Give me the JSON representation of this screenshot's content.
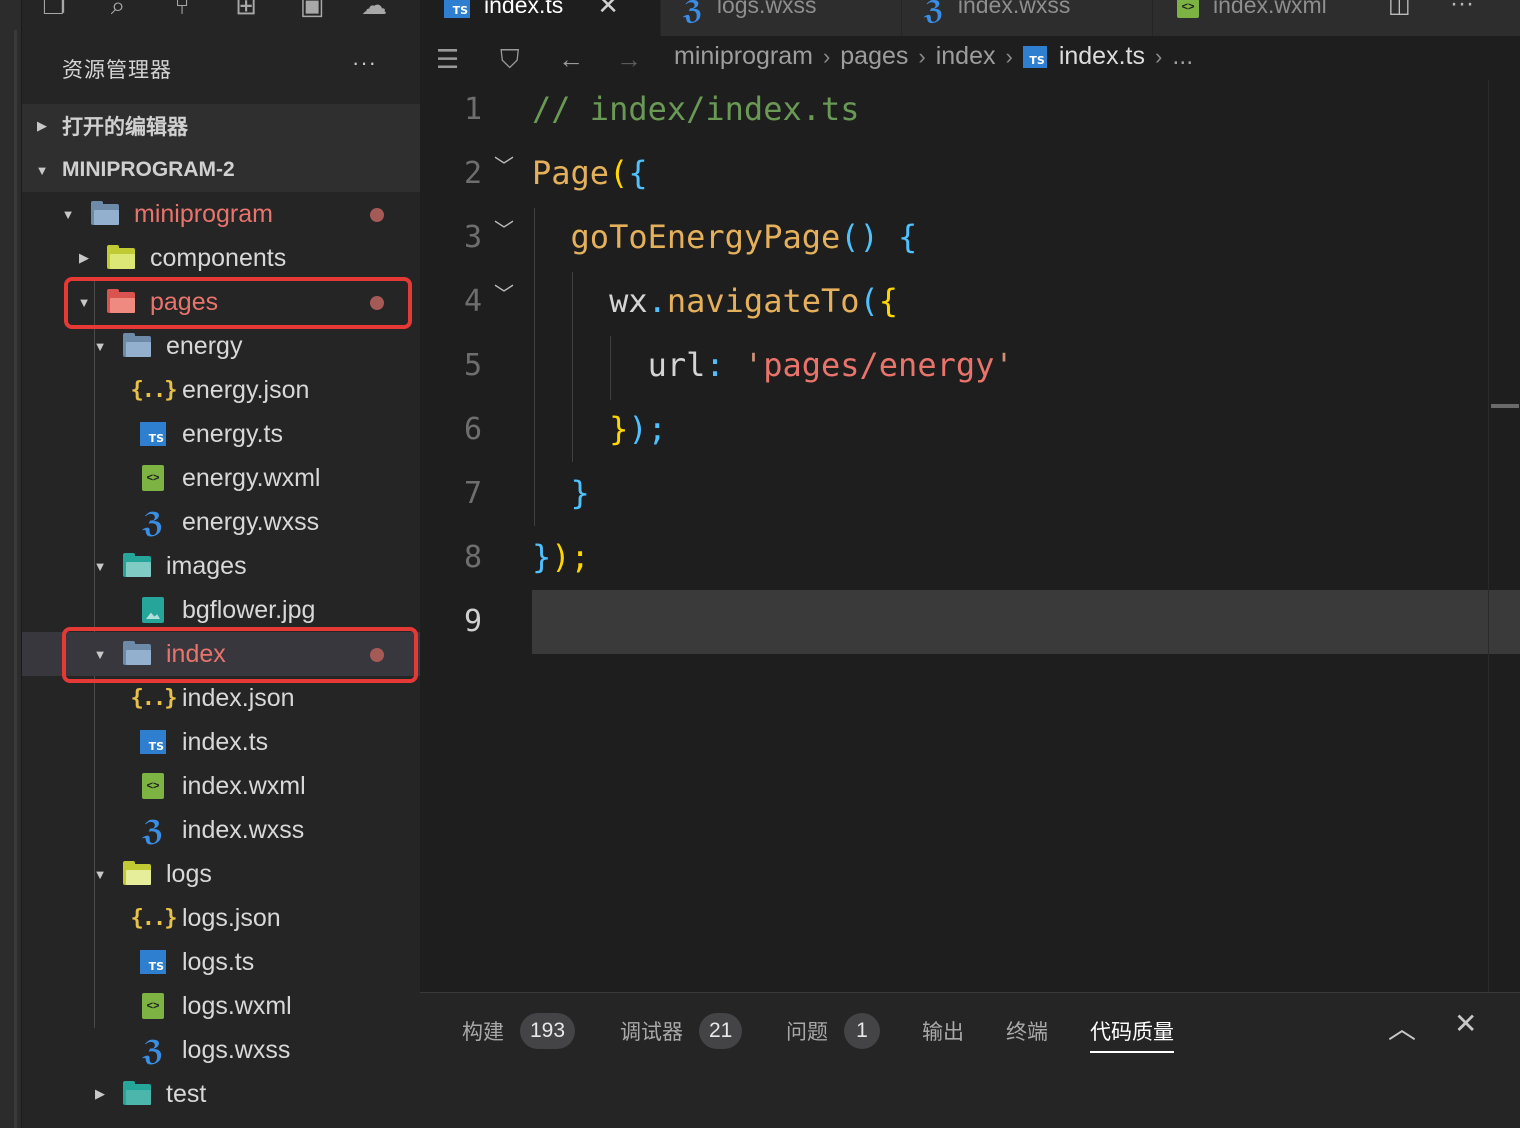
{
  "explorer": {
    "title": "资源管理器",
    "more": "···",
    "sections": [
      {
        "label": "打开的编辑器",
        "expanded": false
      },
      {
        "label": "MINIPROGRAM-2",
        "expanded": true
      }
    ],
    "tree": [
      {
        "name": "miniprogram",
        "type": "folder",
        "expanded": true,
        "modified": true
      },
      {
        "name": "components",
        "type": "folder",
        "expanded": false
      },
      {
        "name": "pages",
        "type": "folder",
        "expanded": true,
        "modified": true,
        "highlighted": true
      },
      {
        "name": "energy",
        "type": "folder",
        "expanded": true
      },
      {
        "name": "energy.json",
        "type": "json"
      },
      {
        "name": "energy.ts",
        "type": "ts"
      },
      {
        "name": "energy.wxml",
        "type": "wxml"
      },
      {
        "name": "energy.wxss",
        "type": "wxss"
      },
      {
        "name": "images",
        "type": "folder",
        "expanded": true
      },
      {
        "name": "bgflower.jpg",
        "type": "image"
      },
      {
        "name": "index",
        "type": "folder",
        "expanded": true,
        "modified": true,
        "highlighted": true,
        "selected": true
      },
      {
        "name": "index.json",
        "type": "json"
      },
      {
        "name": "index.ts",
        "type": "ts"
      },
      {
        "name": "index.wxml",
        "type": "wxml"
      },
      {
        "name": "index.wxss",
        "type": "wxss"
      },
      {
        "name": "logs",
        "type": "folder",
        "expanded": true
      },
      {
        "name": "logs.json",
        "type": "json"
      },
      {
        "name": "logs.ts",
        "type": "ts"
      },
      {
        "name": "logs.wxml",
        "type": "wxml"
      },
      {
        "name": "logs.wxss",
        "type": "wxss"
      },
      {
        "name": "test",
        "type": "folder",
        "expanded": false
      }
    ]
  },
  "tabs": [
    {
      "label": "index.ts",
      "icon": "ts-icon",
      "active": true,
      "close": "✕"
    },
    {
      "label": "logs.wxss",
      "icon": "wxss-icon"
    },
    {
      "label": "index.wxss",
      "icon": "wxss-icon"
    },
    {
      "label": "index.wxml",
      "icon": "wxml-icon"
    }
  ],
  "breadcrumb": [
    "miniprogram",
    "pages",
    "index",
    "index.ts",
    "..."
  ],
  "editor": {
    "current_line": 9,
    "line_numbers": [
      "1",
      "2",
      "3",
      "4",
      "5",
      "6",
      "7",
      "8",
      "9"
    ],
    "lines": [
      "// index/index.ts",
      "Page({",
      "  goToEnergyPage() {",
      "    wx.navigateTo({",
      "      url: 'pages/energy'",
      "    });",
      "  }",
      "});",
      ""
    ]
  },
  "panel": {
    "tabs": [
      {
        "label": "构建",
        "badge": "193"
      },
      {
        "label": "调试器",
        "badge": "21"
      },
      {
        "label": "问题",
        "badge": "1"
      },
      {
        "label": "输出"
      },
      {
        "label": "终端"
      },
      {
        "label": "代码质量",
        "active": true
      }
    ]
  },
  "colors": {
    "modified": "#e8746c",
    "highlight_box": "#e53935",
    "accent_blue": "#2f7fd0"
  }
}
